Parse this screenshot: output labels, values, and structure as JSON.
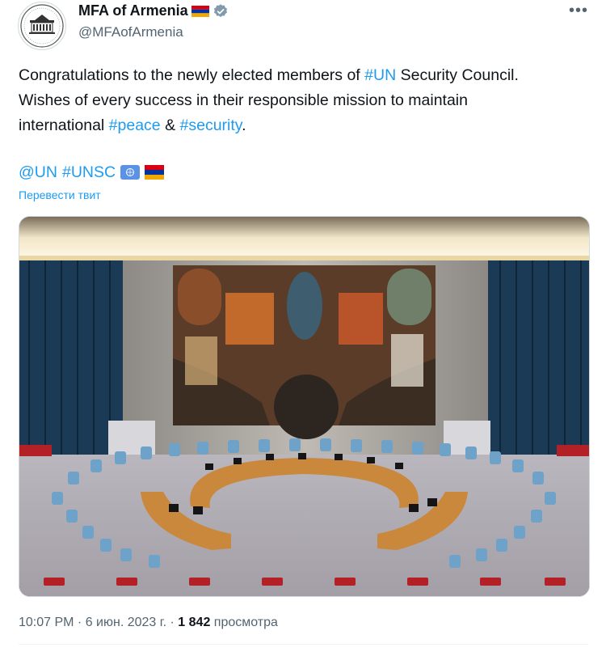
{
  "account": {
    "display_name": "MFA of Armenia",
    "handle": "@MFAofArmenia",
    "avatar_icon": "ministry-building-logo-icon",
    "verified_icon": "verified-badge-icon",
    "flag_icon": "armenia-flag-icon"
  },
  "menu": {
    "more_label": "•••"
  },
  "tweet": {
    "line1_pre": "Congratulations to the newly elected members of ",
    "tag_un": "#UN",
    "line1_post": " Security Council.",
    "line2": "Wishes of every success in their responsible mission to maintain",
    "line3_pre": "international ",
    "tag_peace": "#peace",
    "amp": " & ",
    "tag_security": "#security",
    "line3_post": ".",
    "mention_un": "@UN",
    "tag_unsc": "#UNSC",
    "emoji_icons": [
      "un-flag-icon",
      "armenia-flag-icon"
    ]
  },
  "translate_label": "Перевести твит",
  "media": {
    "description_icon": "un-security-council-chamber-photo"
  },
  "meta": {
    "time": "10:07 PM",
    "sep1": " · ",
    "date": "6 июн. 2023 г.",
    "sep2": " · ",
    "views_count": "1 842",
    "views_label": " просмотра"
  },
  "colors": {
    "link": "#1d9bf0",
    "text": "#0f1419",
    "secondary": "#536471"
  }
}
